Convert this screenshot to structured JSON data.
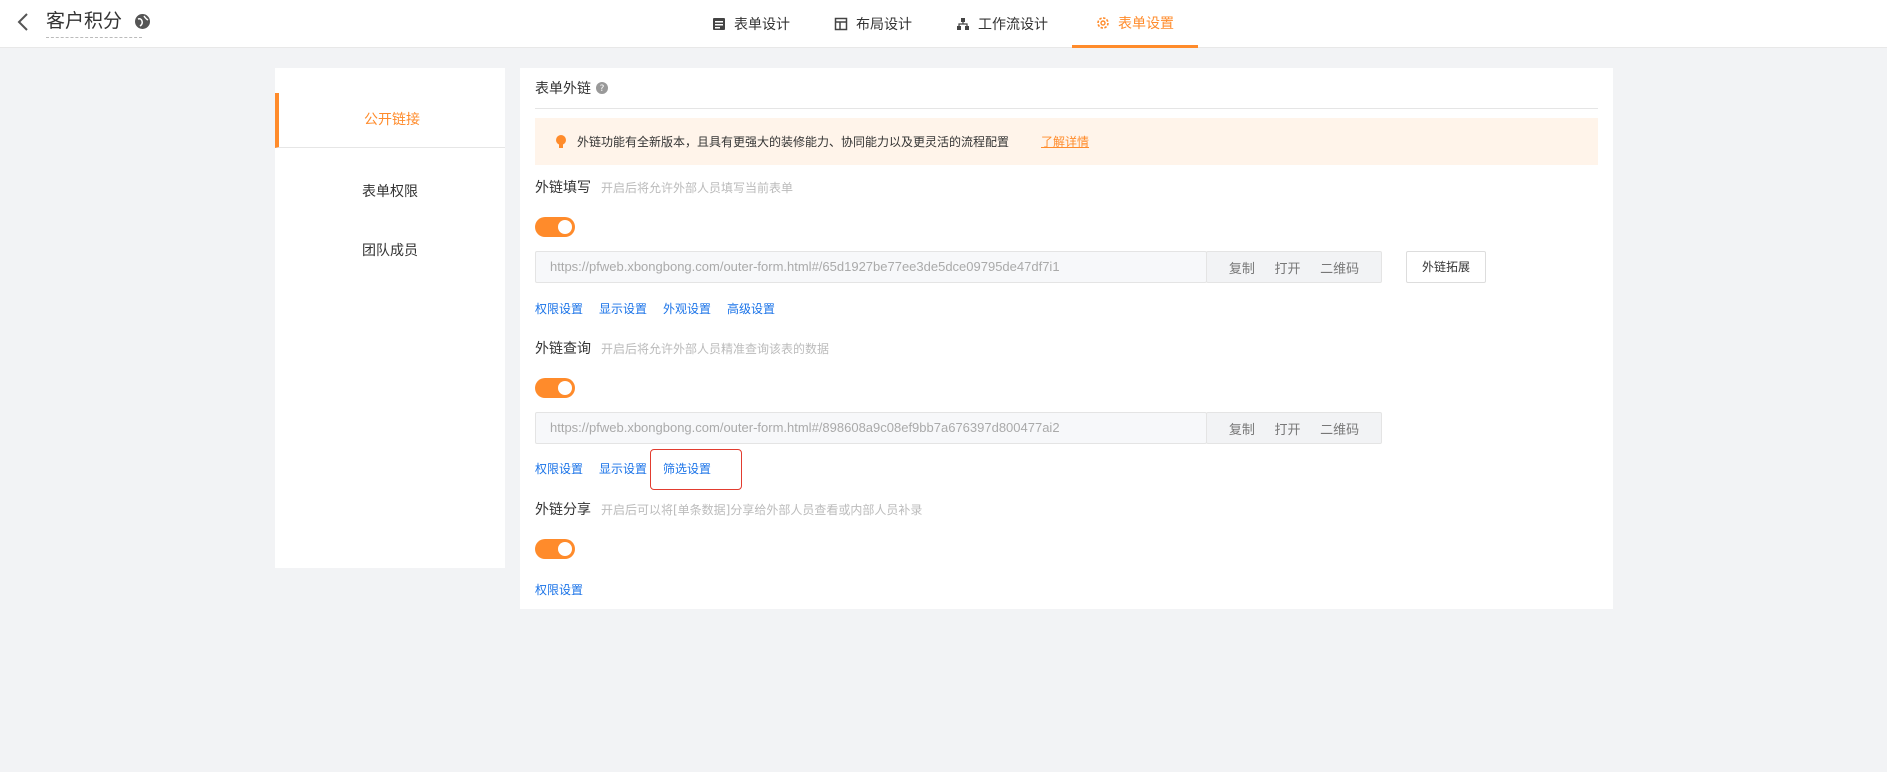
{
  "header": {
    "title": "客户积分",
    "tabs": [
      {
        "label": "表单设计",
        "icon": "form-icon"
      },
      {
        "label": "布局设计",
        "icon": "layout-icon"
      },
      {
        "label": "工作流设计",
        "icon": "workflow-icon"
      },
      {
        "label": "表单设置",
        "icon": "gear-icon",
        "active": true
      }
    ]
  },
  "nav": {
    "items": [
      {
        "label": "公开链接",
        "active": true
      },
      {
        "label": "表单权限"
      },
      {
        "label": "团队成员"
      }
    ]
  },
  "main": {
    "title": "表单外链",
    "notice": {
      "text": "外链功能有全新版本，且具有更强大的装修能力、协同能力以及更灵活的流程配置",
      "link": "了解详情"
    },
    "sections": [
      {
        "title": "外链填写",
        "desc": "开启后将允许外部人员填写当前表单",
        "url": "https://pfweb.xbongbong.com/outer-form.html#/65d1927be77ee3de5dce09795de47df7i1",
        "actions": [
          "复制",
          "打开",
          "二维码"
        ],
        "extra_button": "外链拓展",
        "links": [
          "权限设置",
          "显示设置",
          "外观设置",
          "高级设置"
        ]
      },
      {
        "title": "外链查询",
        "desc": "开启后将允许外部人员精准查询该表的数据",
        "url": "https://pfweb.xbongbong.com/outer-form.html#/898608a9c08ef9bb7a676397d800477ai2",
        "actions": [
          "复制",
          "打开",
          "二维码"
        ],
        "links": [
          "权限设置",
          "显示设置",
          "筛选设置"
        ]
      },
      {
        "title": "外链分享",
        "desc": "开启后可以将[单条数据]分享给外部人员查看或内部人员补录",
        "links": [
          "权限设置"
        ]
      }
    ]
  },
  "colors": {
    "accent": "#ff8b2b",
    "link": "#1a73e8",
    "highlight": "#e23c2f"
  }
}
